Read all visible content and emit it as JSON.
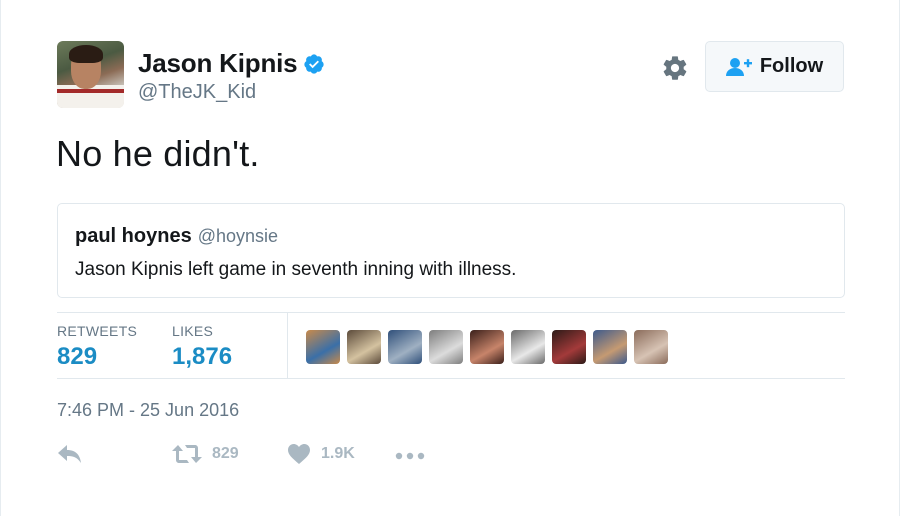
{
  "author": {
    "display_name": "Jason Kipnis",
    "handle": "@TheJK_Kid",
    "verified": true
  },
  "follow_button": {
    "label": "Follow"
  },
  "tweet": {
    "text": "No he didn't.",
    "timestamp": "7:46 PM - 25 Jun 2016"
  },
  "quoted_tweet": {
    "name": "paul hoynes",
    "handle": "@hoynsie",
    "text": "Jason Kipnis left game in seventh inning with illness."
  },
  "stats": {
    "retweets_label": "RETWEETS",
    "retweets_value": "829",
    "likes_label": "LIKES",
    "likes_value": "1,876"
  },
  "likers": [
    {
      "colors": [
        "#c98a4a",
        "#3a6fa8"
      ]
    },
    {
      "colors": [
        "#5b4a3a",
        "#d4c2a0"
      ]
    },
    {
      "colors": [
        "#2f4f7a",
        "#9fb0c2"
      ]
    },
    {
      "colors": [
        "#7d7d7d",
        "#dcdcdc"
      ]
    },
    {
      "colors": [
        "#3a1f1a",
        "#c7846a"
      ]
    },
    {
      "colors": [
        "#6a6a6a",
        "#e8e8e8"
      ]
    },
    {
      "colors": [
        "#2c1a17",
        "#a33a3a"
      ]
    },
    {
      "colors": [
        "#3d5a8c",
        "#c59a72"
      ]
    },
    {
      "colors": [
        "#8a6b5a",
        "#d7c3b4"
      ]
    }
  ],
  "actions": {
    "reply_icon": "reply-icon",
    "retweet_count": "829",
    "like_count": "1.9K",
    "more_icon": "more-icon"
  },
  "colors": {
    "link_blue": "#1b8cc4",
    "verified_blue": "#1da1f2",
    "muted": "#657786",
    "action_gray": "#aab8c2"
  }
}
